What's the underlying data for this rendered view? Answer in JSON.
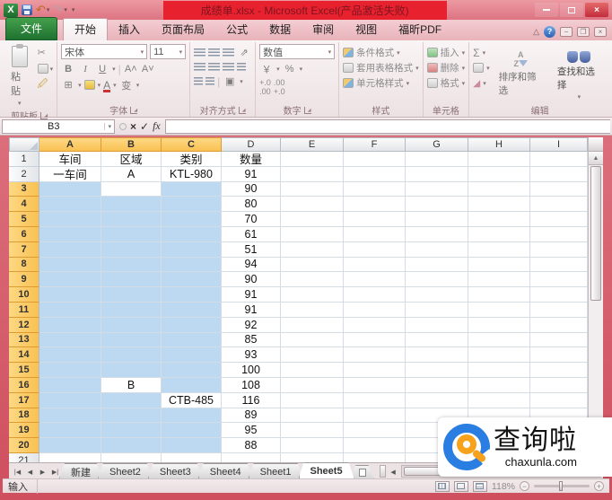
{
  "window": {
    "title": "成绩单.xlsx - Microsoft Excel(产品激活失败)"
  },
  "ribbon_tabs": [
    {
      "label": "文件",
      "type": "file"
    },
    {
      "label": "开始",
      "active": true
    },
    {
      "label": "插入"
    },
    {
      "label": "页面布局"
    },
    {
      "label": "公式"
    },
    {
      "label": "数据"
    },
    {
      "label": "审阅"
    },
    {
      "label": "视图"
    },
    {
      "label": "福昕PDF"
    }
  ],
  "ribbon": {
    "clipboard": {
      "label": "剪贴板",
      "paste": "粘贴"
    },
    "font": {
      "label": "字体",
      "name": "宋体",
      "size": "11",
      "phonetic": "变"
    },
    "alignment": {
      "label": "对齐方式"
    },
    "number": {
      "label": "数字",
      "format": "数值"
    },
    "styles": {
      "label": "样式",
      "conditional": "条件格式",
      "table_format": "套用表格格式",
      "cell_styles": "单元格样式"
    },
    "cells": {
      "label": "单元格",
      "insert": "插入",
      "delete": "删除",
      "format": "格式"
    },
    "editing": {
      "label": "编辑",
      "sort": "排序和筛选",
      "find": "查找和选择"
    }
  },
  "formula_bar": {
    "name_box": "B3"
  },
  "grid": {
    "columns": [
      "A",
      "B",
      "C",
      "D",
      "E",
      "F",
      "G",
      "H",
      "I"
    ],
    "col_widths": {
      "A": 69,
      "B": 67,
      "C": 67,
      "D": 66,
      "E": 70,
      "F": 69,
      "G": 70,
      "H": 69,
      "I": 64
    },
    "visible_rows": 21,
    "selection": {
      "cols": [
        "A",
        "B",
        "C"
      ],
      "row_start": 3,
      "row_end": 20,
      "active_cell": "B3",
      "excluded": [
        "B16",
        "C17"
      ]
    },
    "cells": {
      "A1": "车间",
      "B1": "区域",
      "C1": "类别",
      "D1": "数量",
      "A2": "一车间",
      "B2": "A",
      "C2": "KTL-980",
      "D2": "91",
      "D3": "90",
      "D4": "80",
      "D5": "70",
      "D6": "61",
      "D7": "51",
      "D8": "94",
      "D9": "90",
      "D10": "91",
      "D11": "91",
      "D12": "92",
      "D13": "85",
      "D14": "93",
      "D15": "100",
      "B16": "B",
      "D16": "108",
      "C17": "CTB-485",
      "D17": "116",
      "D18": "89",
      "D19": "95",
      "D20": "88"
    }
  },
  "sheet_tabs": {
    "items": [
      "新建",
      "Sheet2",
      "Sheet3",
      "Sheet4",
      "Sheet1",
      "Sheet5"
    ],
    "active": "Sheet5"
  },
  "status_bar": {
    "mode": "输入",
    "zoom": "118%"
  },
  "watermark": {
    "name": "查询啦",
    "domain": "chaxunla.com"
  },
  "icons": {
    "bold": "B",
    "italic": "I",
    "underline": "U",
    "grow_font": "A˄",
    "shrink_font": "A˅",
    "sum": "Σ",
    "undo": "↶",
    "redo": "↷",
    "cut": "✂",
    "cancel": "×",
    "check": "✓",
    "fx": "fx",
    "border": "⊞",
    "currency": "￥",
    "percent": "%",
    "comma": "٫",
    "inc_decimal": "+.0",
    "dec_decimal": ".00",
    "orientation": "⇗",
    "fill": "⬇",
    "clear": "⌫",
    "sort_az": "A↓Z",
    "up_arrow": "▲",
    "down_arrow": "▼",
    "left_arrow": "◀",
    "right_arrow": "▶",
    "nav_first": "|◀",
    "nav_prev": "◀",
    "nav_next": "▶",
    "nav_last": "▶|",
    "minimize": "—",
    "help": "?",
    "ribbon_collapse": "△",
    "minus": "−",
    "plus": "+",
    "close": "×"
  },
  "colors": {
    "red-border": "#cf4f5e",
    "red-border-light": "#e07a86",
    "titlebar-1": "#ec9aa3",
    "titlebar-2": "#dd7381",
    "title-red": "#e8212e",
    "tabrow-1": "#f3cdd2",
    "tabrow-2": "#e9b3ba",
    "hdr-amber-1": "#fdd883",
    "hdr-amber-2": "#f9c153",
    "hdr-amber-bd": "#dd9c33",
    "sel-blue": "#bdd8f1",
    "grid-line": "#d4dce6",
    "logo-blue": "#2a7de1",
    "logo-orange": "#f6a21d",
    "file-green": "#2c7d3a"
  }
}
